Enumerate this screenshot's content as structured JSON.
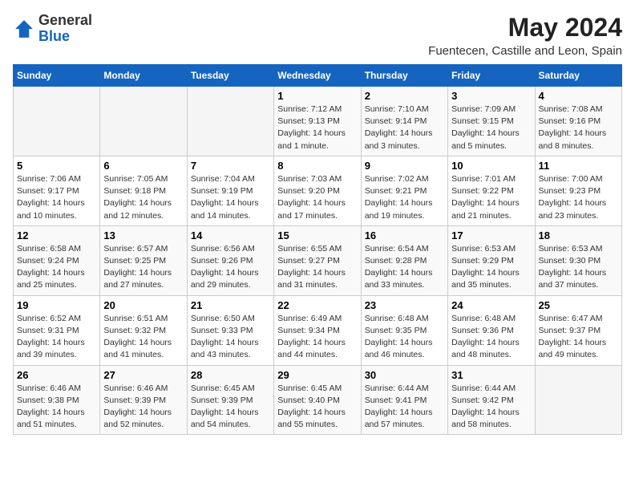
{
  "header": {
    "logo_general": "General",
    "logo_blue": "Blue",
    "month_title": "May 2024",
    "subtitle": "Fuentecen, Castille and Leon, Spain"
  },
  "days_of_week": [
    "Sunday",
    "Monday",
    "Tuesday",
    "Wednesday",
    "Thursday",
    "Friday",
    "Saturday"
  ],
  "weeks": [
    [
      {
        "day": "",
        "sunrise": "",
        "sunset": "",
        "daylight": ""
      },
      {
        "day": "",
        "sunrise": "",
        "sunset": "",
        "daylight": ""
      },
      {
        "day": "",
        "sunrise": "",
        "sunset": "",
        "daylight": ""
      },
      {
        "day": "1",
        "sunrise": "Sunrise: 7:12 AM",
        "sunset": "Sunset: 9:13 PM",
        "daylight": "Daylight: 14 hours and 1 minute."
      },
      {
        "day": "2",
        "sunrise": "Sunrise: 7:10 AM",
        "sunset": "Sunset: 9:14 PM",
        "daylight": "Daylight: 14 hours and 3 minutes."
      },
      {
        "day": "3",
        "sunrise": "Sunrise: 7:09 AM",
        "sunset": "Sunset: 9:15 PM",
        "daylight": "Daylight: 14 hours and 5 minutes."
      },
      {
        "day": "4",
        "sunrise": "Sunrise: 7:08 AM",
        "sunset": "Sunset: 9:16 PM",
        "daylight": "Daylight: 14 hours and 8 minutes."
      }
    ],
    [
      {
        "day": "5",
        "sunrise": "Sunrise: 7:06 AM",
        "sunset": "Sunset: 9:17 PM",
        "daylight": "Daylight: 14 hours and 10 minutes."
      },
      {
        "day": "6",
        "sunrise": "Sunrise: 7:05 AM",
        "sunset": "Sunset: 9:18 PM",
        "daylight": "Daylight: 14 hours and 12 minutes."
      },
      {
        "day": "7",
        "sunrise": "Sunrise: 7:04 AM",
        "sunset": "Sunset: 9:19 PM",
        "daylight": "Daylight: 14 hours and 14 minutes."
      },
      {
        "day": "8",
        "sunrise": "Sunrise: 7:03 AM",
        "sunset": "Sunset: 9:20 PM",
        "daylight": "Daylight: 14 hours and 17 minutes."
      },
      {
        "day": "9",
        "sunrise": "Sunrise: 7:02 AM",
        "sunset": "Sunset: 9:21 PM",
        "daylight": "Daylight: 14 hours and 19 minutes."
      },
      {
        "day": "10",
        "sunrise": "Sunrise: 7:01 AM",
        "sunset": "Sunset: 9:22 PM",
        "daylight": "Daylight: 14 hours and 21 minutes."
      },
      {
        "day": "11",
        "sunrise": "Sunrise: 7:00 AM",
        "sunset": "Sunset: 9:23 PM",
        "daylight": "Daylight: 14 hours and 23 minutes."
      }
    ],
    [
      {
        "day": "12",
        "sunrise": "Sunrise: 6:58 AM",
        "sunset": "Sunset: 9:24 PM",
        "daylight": "Daylight: 14 hours and 25 minutes."
      },
      {
        "day": "13",
        "sunrise": "Sunrise: 6:57 AM",
        "sunset": "Sunset: 9:25 PM",
        "daylight": "Daylight: 14 hours and 27 minutes."
      },
      {
        "day": "14",
        "sunrise": "Sunrise: 6:56 AM",
        "sunset": "Sunset: 9:26 PM",
        "daylight": "Daylight: 14 hours and 29 minutes."
      },
      {
        "day": "15",
        "sunrise": "Sunrise: 6:55 AM",
        "sunset": "Sunset: 9:27 PM",
        "daylight": "Daylight: 14 hours and 31 minutes."
      },
      {
        "day": "16",
        "sunrise": "Sunrise: 6:54 AM",
        "sunset": "Sunset: 9:28 PM",
        "daylight": "Daylight: 14 hours and 33 minutes."
      },
      {
        "day": "17",
        "sunrise": "Sunrise: 6:53 AM",
        "sunset": "Sunset: 9:29 PM",
        "daylight": "Daylight: 14 hours and 35 minutes."
      },
      {
        "day": "18",
        "sunrise": "Sunrise: 6:53 AM",
        "sunset": "Sunset: 9:30 PM",
        "daylight": "Daylight: 14 hours and 37 minutes."
      }
    ],
    [
      {
        "day": "19",
        "sunrise": "Sunrise: 6:52 AM",
        "sunset": "Sunset: 9:31 PM",
        "daylight": "Daylight: 14 hours and 39 minutes."
      },
      {
        "day": "20",
        "sunrise": "Sunrise: 6:51 AM",
        "sunset": "Sunset: 9:32 PM",
        "daylight": "Daylight: 14 hours and 41 minutes."
      },
      {
        "day": "21",
        "sunrise": "Sunrise: 6:50 AM",
        "sunset": "Sunset: 9:33 PM",
        "daylight": "Daylight: 14 hours and 43 minutes."
      },
      {
        "day": "22",
        "sunrise": "Sunrise: 6:49 AM",
        "sunset": "Sunset: 9:34 PM",
        "daylight": "Daylight: 14 hours and 44 minutes."
      },
      {
        "day": "23",
        "sunrise": "Sunrise: 6:48 AM",
        "sunset": "Sunset: 9:35 PM",
        "daylight": "Daylight: 14 hours and 46 minutes."
      },
      {
        "day": "24",
        "sunrise": "Sunrise: 6:48 AM",
        "sunset": "Sunset: 9:36 PM",
        "daylight": "Daylight: 14 hours and 48 minutes."
      },
      {
        "day": "25",
        "sunrise": "Sunrise: 6:47 AM",
        "sunset": "Sunset: 9:37 PM",
        "daylight": "Daylight: 14 hours and 49 minutes."
      }
    ],
    [
      {
        "day": "26",
        "sunrise": "Sunrise: 6:46 AM",
        "sunset": "Sunset: 9:38 PM",
        "daylight": "Daylight: 14 hours and 51 minutes."
      },
      {
        "day": "27",
        "sunrise": "Sunrise: 6:46 AM",
        "sunset": "Sunset: 9:39 PM",
        "daylight": "Daylight: 14 hours and 52 minutes."
      },
      {
        "day": "28",
        "sunrise": "Sunrise: 6:45 AM",
        "sunset": "Sunset: 9:39 PM",
        "daylight": "Daylight: 14 hours and 54 minutes."
      },
      {
        "day": "29",
        "sunrise": "Sunrise: 6:45 AM",
        "sunset": "Sunset: 9:40 PM",
        "daylight": "Daylight: 14 hours and 55 minutes."
      },
      {
        "day": "30",
        "sunrise": "Sunrise: 6:44 AM",
        "sunset": "Sunset: 9:41 PM",
        "daylight": "Daylight: 14 hours and 57 minutes."
      },
      {
        "day": "31",
        "sunrise": "Sunrise: 6:44 AM",
        "sunset": "Sunset: 9:42 PM",
        "daylight": "Daylight: 14 hours and 58 minutes."
      },
      {
        "day": "",
        "sunrise": "",
        "sunset": "",
        "daylight": ""
      }
    ]
  ]
}
